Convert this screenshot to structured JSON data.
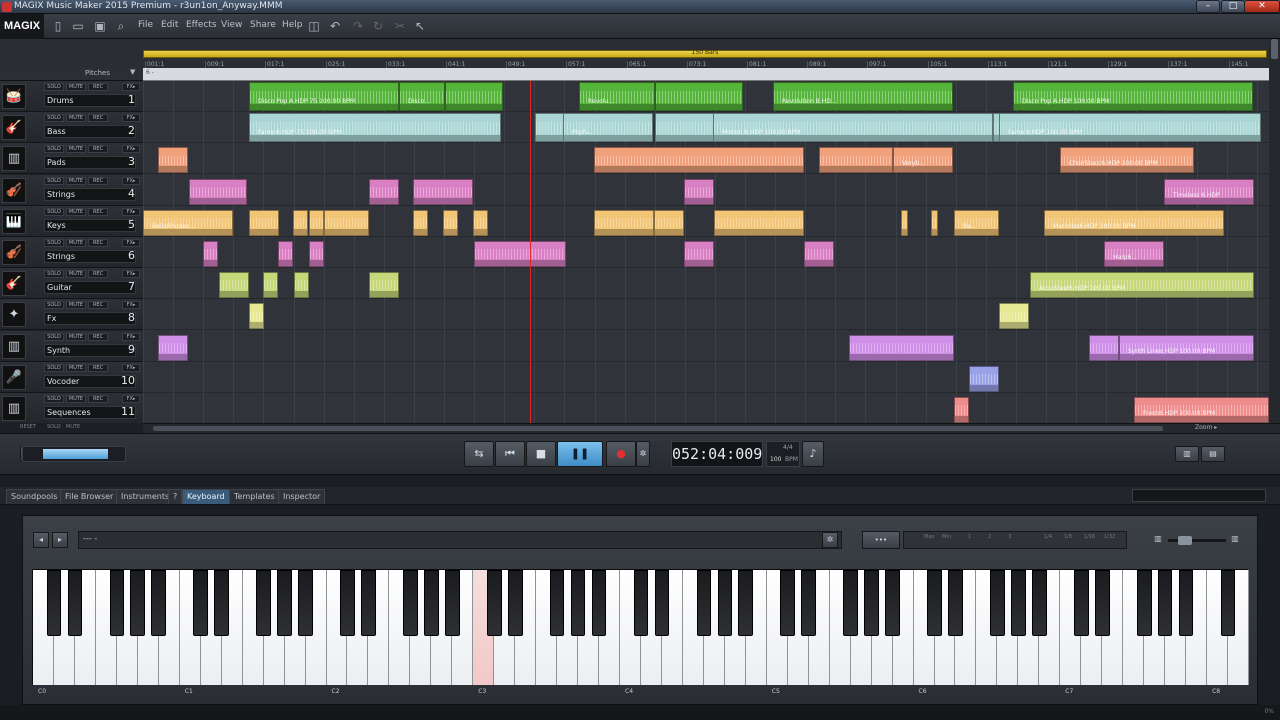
{
  "window": {
    "title": "MAGIX Music Maker 2015 Premium - r3un1on_Anyway.MMM",
    "minimize_label": "–",
    "maximize_label": "□",
    "close_label": "✕"
  },
  "menubar": {
    "logo": "MAGIX",
    "items": [
      "File",
      "Edit",
      "Effects",
      "View",
      "Share",
      "Help"
    ]
  },
  "ruler": {
    "length_label": "150 Bars",
    "ticks": [
      "001:1",
      "009:1",
      "017:1",
      "025:1",
      "033:1",
      "041:1",
      "049:1",
      "057:1",
      "065:1",
      "073:1",
      "081:1",
      "089:1",
      "097:1",
      "105:1",
      "113:1",
      "121:1",
      "129:1",
      "137:1",
      "145:1"
    ],
    "pitches_label": "Pitches",
    "lane_label": "6 -"
  },
  "track_buttons": {
    "solo": "SOLO",
    "mute": "MUTE",
    "rec": "REC",
    "fx": "FX▸"
  },
  "tracks": [
    {
      "name": "Drums",
      "number": "1",
      "icon": "drum-kit-icon",
      "glyph": "🥁"
    },
    {
      "name": "Bass",
      "number": "2",
      "icon": "bass-guitar-icon",
      "glyph": "🎸"
    },
    {
      "name": "Pads",
      "number": "3",
      "icon": "pads-icon",
      "glyph": "▥"
    },
    {
      "name": "Strings",
      "number": "4",
      "icon": "violin-icon",
      "glyph": "🎻"
    },
    {
      "name": "Keys",
      "number": "5",
      "icon": "keyboard-icon",
      "glyph": "🎹"
    },
    {
      "name": "Strings",
      "number": "6",
      "icon": "violin-icon",
      "glyph": "🎻"
    },
    {
      "name": "Guitar",
      "number": "7",
      "icon": "guitar-icon",
      "glyph": "🎸"
    },
    {
      "name": "Fx",
      "number": "8",
      "icon": "fx-icon",
      "glyph": "✦"
    },
    {
      "name": "Synth",
      "number": "9",
      "icon": "synth-icon",
      "glyph": "▥"
    },
    {
      "name": "Vocoder",
      "number": "10",
      "icon": "microphone-icon",
      "glyph": "🎤"
    },
    {
      "name": "Sequences",
      "number": "11",
      "icon": "sequencer-icon",
      "glyph": "▥"
    }
  ],
  "track_footer": {
    "reset": "RESET",
    "solo": "SOLO",
    "mute": "MUTE"
  },
  "clip_labels": {
    "disco_pop": "Disco Pop A.HDP  75  100.00 BPM",
    "disco": "Disco...",
    "revolu": "Revolu...",
    "revolution": "Revolution B.HD...",
    "disco_pop_2": "Disco Pop A.HDP  100.00 BPM",
    "fame": "Fame 6.HDP  75  100.00 BPM",
    "popfu": "Popfu...",
    "motion": "Motion 8.HDP  100.00 BPM",
    "fame2": "Fame 6.HDP  100.00 BPM",
    "veryb": "Veryb...",
    "choir": "ChoirStacc6.HDP  100.00 BPM",
    "timeless": "Timeless 6.HDP",
    "bella": "BellaRhodes...",
    "ba": "Ba...",
    "marimba": "Marimba6.HDP  100.00 BPM",
    "harp": "Harp6...",
    "acou": "AcouSteel6.HDP  100.00 BPM",
    "synthlines": "Synth Lines.HDP  100.00 BPM",
    "seq": "Fresh6.HDP  100.00 BPM"
  },
  "transport": {
    "time": "052:04:009",
    "time_signature": "4/4",
    "tempo": "100",
    "tempo_unit": "BPM",
    "loop_label": "⇆",
    "rewind_label": "⏮",
    "stop_label": "■",
    "pause_label": "❚❚",
    "record_label": "●",
    "settings_label": "✲",
    "metronome_label": "♪",
    "zoom_label": "Zoom ▸",
    "master_volume": 0.65
  },
  "tabs": [
    {
      "label": "Soundpools",
      "active": false
    },
    {
      "label": "File Browser",
      "active": false
    },
    {
      "label": "Instruments",
      "active": false
    },
    {
      "label": "?",
      "active": false
    },
    {
      "label": "Keyboard",
      "active": true
    },
    {
      "label": "Templates",
      "active": false
    },
    {
      "label": "Inspector",
      "active": false
    }
  ],
  "keyboard": {
    "instrument_field": "--- -",
    "octave_labels": [
      "C0",
      "C1",
      "C2",
      "C3",
      "C4",
      "C5",
      "C6",
      "C7",
      "C8"
    ],
    "arp_ticks": [
      "Max",
      "Min",
      "1",
      "2",
      "3",
      "1/4",
      "1/8",
      "1/16",
      "1/32"
    ]
  },
  "colors": {
    "drums": "#55b43a",
    "bass": "#a9d6d4",
    "pads": "#f0a17c",
    "strings": "#d97fc3",
    "keys": "#f2c576",
    "guitar": "#c6d77a",
    "fx": "#e6e894",
    "synth": "#cf8ee7",
    "vocoder": "#9aa1e6",
    "sequences": "#ef8c8c",
    "accent": "#4f9fd8",
    "playhead": "#e02828"
  }
}
